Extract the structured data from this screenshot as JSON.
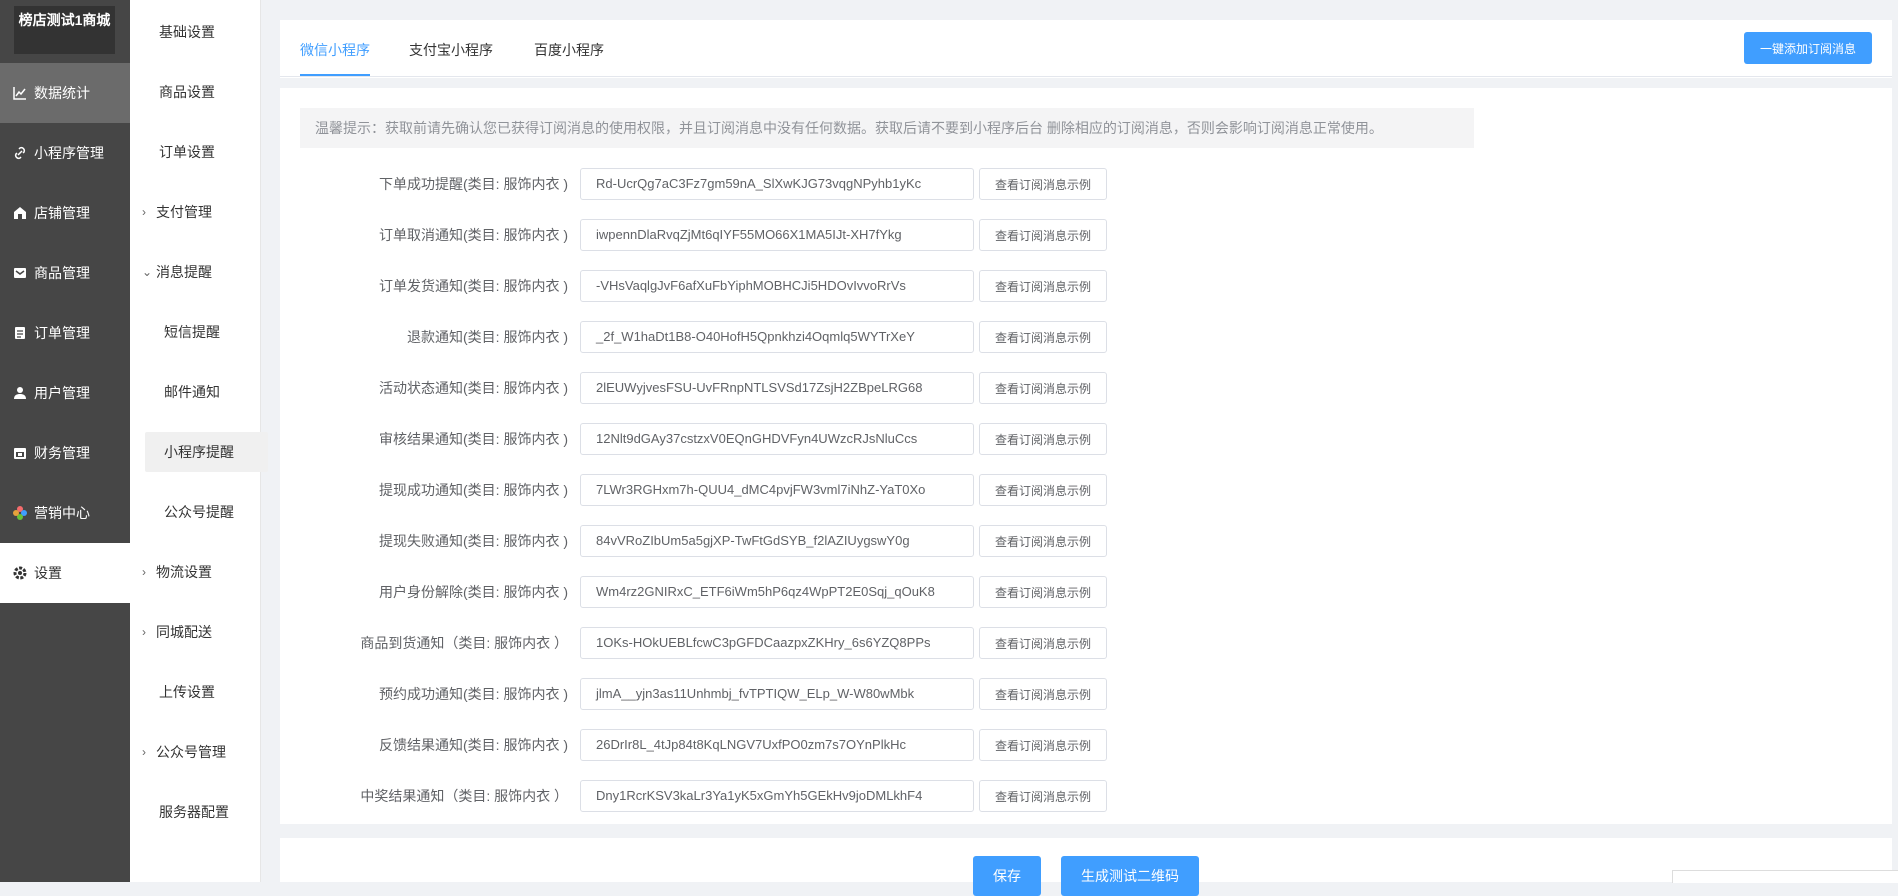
{
  "shop": {
    "name": "榜店测试1商城"
  },
  "main_nav": [
    {
      "label": "数据统计",
      "icon": "chart-line-icon"
    },
    {
      "label": "小程序管理",
      "icon": "link-icon"
    },
    {
      "label": "店铺管理",
      "icon": "store-icon"
    },
    {
      "label": "商品管理",
      "icon": "box-icon"
    },
    {
      "label": "订单管理",
      "icon": "clipboard-icon"
    },
    {
      "label": "用户管理",
      "icon": "user-icon"
    },
    {
      "label": "财务管理",
      "icon": "calendar-icon"
    },
    {
      "label": "营销中心",
      "icon": "flower-icon"
    },
    {
      "label": "设置",
      "icon": "gear-icon"
    }
  ],
  "sub_nav": [
    {
      "label": "基础设置"
    },
    {
      "label": "商品设置"
    },
    {
      "label": "订单设置"
    },
    {
      "label": "支付管理"
    },
    {
      "label": "消息提醒"
    },
    {
      "label": "短信提醒"
    },
    {
      "label": "邮件通知"
    },
    {
      "label": "小程序提醒"
    },
    {
      "label": "公众号提醒"
    },
    {
      "label": "物流设置"
    },
    {
      "label": "同城配送"
    },
    {
      "label": "上传设置"
    },
    {
      "label": "公众号管理"
    },
    {
      "label": "服务器配置"
    }
  ],
  "tabs": [
    {
      "label": "微信小程序"
    },
    {
      "label": "支付宝小程序"
    },
    {
      "label": "百度小程序"
    }
  ],
  "add_button": "一键添加订阅消息",
  "tip": "温馨提示：获取前请先确认您已获得订阅消息的使用权限，并且订阅消息中没有任何数据。获取后请不要到小程序后台 删除相应的订阅消息，否则会影响订阅消息正常使用。",
  "example_button": "查看订阅消息示例",
  "rows": [
    {
      "label": "下单成功提醒(类目: 服饰内衣 )",
      "value": "Rd-UcrQg7aC3Fz7gm59nA_SlXwKJG73vqgNPyhb1yKc"
    },
    {
      "label": "订单取消通知(类目: 服饰内衣 )",
      "value": "iwpennDlaRvqZjMt6qIYF55MO66X1MA5IJt-XH7fYkg"
    },
    {
      "label": "订单发货通知(类目: 服饰内衣 )",
      "value": "-VHsVaqlgJvF6afXuFbYiphMOBHCJi5HDOvIvvoRrVs"
    },
    {
      "label": "退款通知(类目: 服饰内衣 )",
      "value": "_2f_W1haDt1B8-O40HofH5Qpnkhzi4Oqmlq5WYTrXeY"
    },
    {
      "label": "活动状态通知(类目: 服饰内衣 )",
      "value": "2lEUWyjvesFSU-UvFRnpNTLSVSd17ZsjH2ZBpeLRG68"
    },
    {
      "label": "审核结果通知(类目: 服饰内衣 )",
      "value": "12Nlt9dGAy37cstzxV0EQnGHDVFyn4UWzcRJsNluCcs"
    },
    {
      "label": "提现成功通知(类目: 服饰内衣 )",
      "value": "7LWr3RGHxm7h-QUU4_dMC4pvjFW3vml7iNhZ-YaT0Xo"
    },
    {
      "label": "提现失败通知(类目: 服饰内衣 )",
      "value": "84vVRoZIbUm5a5gjXP-TwFtGdSYB_f2lAZIUygswY0g"
    },
    {
      "label": "用户身份解除(类目: 服饰内衣 )",
      "value": "Wm4rz2GNIRxC_ETF6iWm5hP6qz4WpPT2E0Sqj_qOuK8"
    },
    {
      "label": "商品到货通知（类目: 服饰内衣 ）",
      "value": "1OKs-HOkUEBLfcwC3pGFDCaazpxZKHry_6s6YZQ8PPs"
    },
    {
      "label": "预约成功通知(类目: 服饰内衣 )",
      "value": "jlmA__yjn3as11Unhmbj_fvTPTIQW_ELp_W-W80wMbk"
    },
    {
      "label": "反馈结果通知(类目: 服饰内衣 )",
      "value": "26DrIr8L_4tJp84t8KqLNGV7UxfPO0zm7s7OYnPlkHc"
    },
    {
      "label": "中奖结果通知（类目: 服饰内衣 ）",
      "value": "Dny1RcrKSV3kaLr3Ya1yK5xGmYh5GEkHv9joDMLkhF4"
    }
  ],
  "save_button": "保存",
  "qrcode_button": "生成测试二维码",
  "colors": {
    "accent": "#409eff",
    "sidebar": "#464646"
  }
}
